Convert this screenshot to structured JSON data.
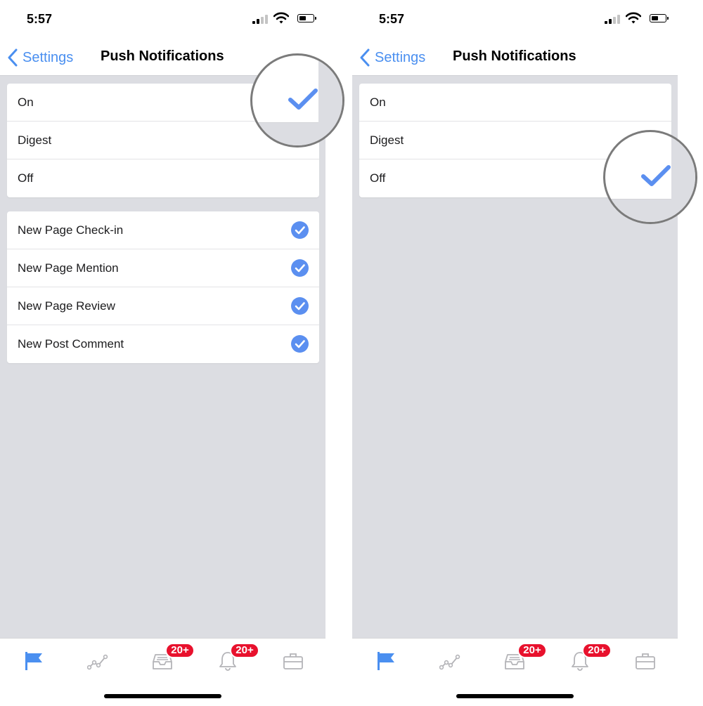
{
  "status_bar": {
    "time": "5:57"
  },
  "nav": {
    "back_label": "Settings",
    "title": "Push Notifications"
  },
  "options": [
    "On",
    "Digest",
    "Off"
  ],
  "categories": [
    "New Page Check-in",
    "New Page Mention",
    "New Page Review",
    "New Post Comment"
  ],
  "screens": [
    {
      "selected_option": "On",
      "categories_visible": true
    },
    {
      "selected_option": "Off",
      "categories_visible": false
    }
  ],
  "tabbar": {
    "tabs": [
      "flag-icon",
      "insights-icon",
      "inbox-icon",
      "bell-icon",
      "briefcase-icon"
    ],
    "inbox_badge": "20+",
    "notifications_badge": "20+"
  },
  "colors": {
    "accent": "#4a8ff0",
    "checkmark": "#5b8ff0",
    "badge": "#e8112d",
    "background": "#dcdde2",
    "tab_inactive": "#b4b4b8"
  }
}
